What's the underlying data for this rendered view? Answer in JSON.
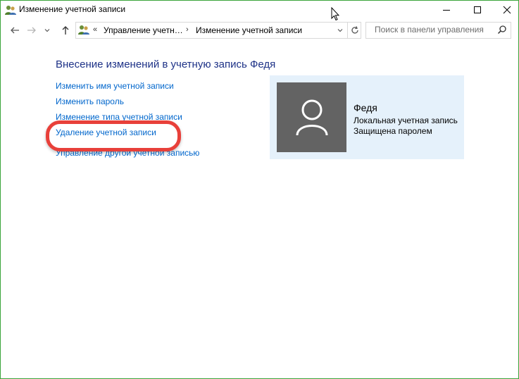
{
  "window": {
    "title": "Изменение учетной записи",
    "title_icon": "user-accounts-icon",
    "accent_border": "#3aa53a"
  },
  "address_bar": {
    "chevron": "«",
    "segments": [
      "Управление учетн…",
      "Изменение учетной записи"
    ],
    "separator": "›"
  },
  "search": {
    "placeholder": "Поиск в панели управления"
  },
  "main": {
    "heading": "Внесение изменений в учетную запись Федя",
    "links": [
      "Изменить имя учетной записи",
      "Изменить пароль",
      "Изменение типа учетной записи",
      "Удаление учетной записи",
      "Управление другой учетной записью"
    ],
    "highlighted_link_index": 3,
    "highlight_color": "#e8403a"
  },
  "account": {
    "name": "Федя",
    "type": "Локальная учетная запись",
    "status": "Защищена паролем",
    "card_color": "#e5f1fb",
    "avatar_color": "#636363"
  }
}
